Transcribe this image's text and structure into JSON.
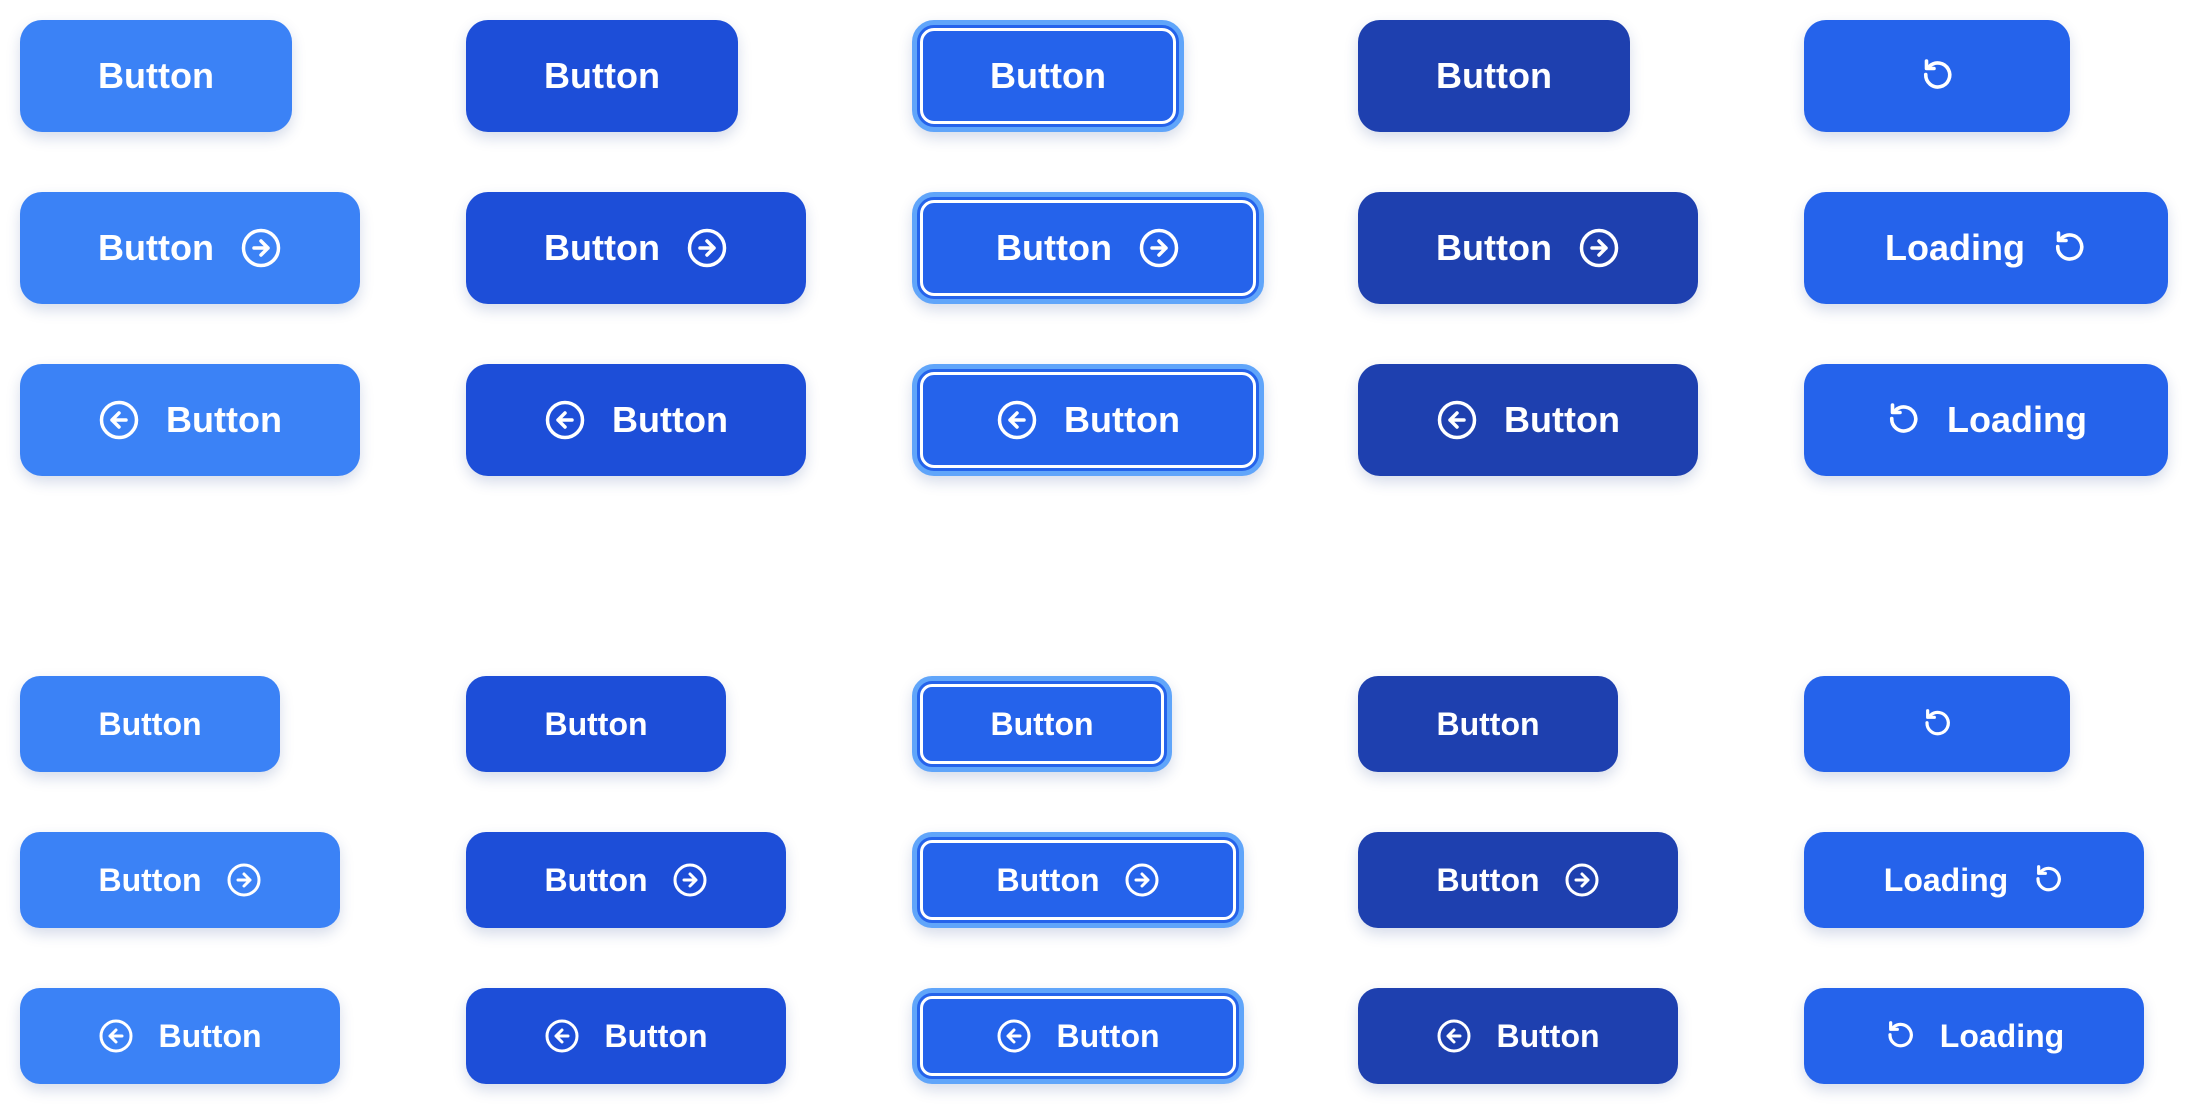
{
  "labels": {
    "button": "Button",
    "loading": "Loading"
  },
  "colors": {
    "default": "#3b82f6",
    "hover": "#1d4ed8",
    "focus": "#2563eb",
    "focus_ring": "#60a5fa",
    "pressed": "#1e40af",
    "loading": "#2563eb",
    "text": "#ffffff"
  },
  "icons": {
    "arrow_right": "arrow-right-circle-icon",
    "arrow_left": "arrow-left-circle-icon",
    "loading": "refresh-icon"
  }
}
